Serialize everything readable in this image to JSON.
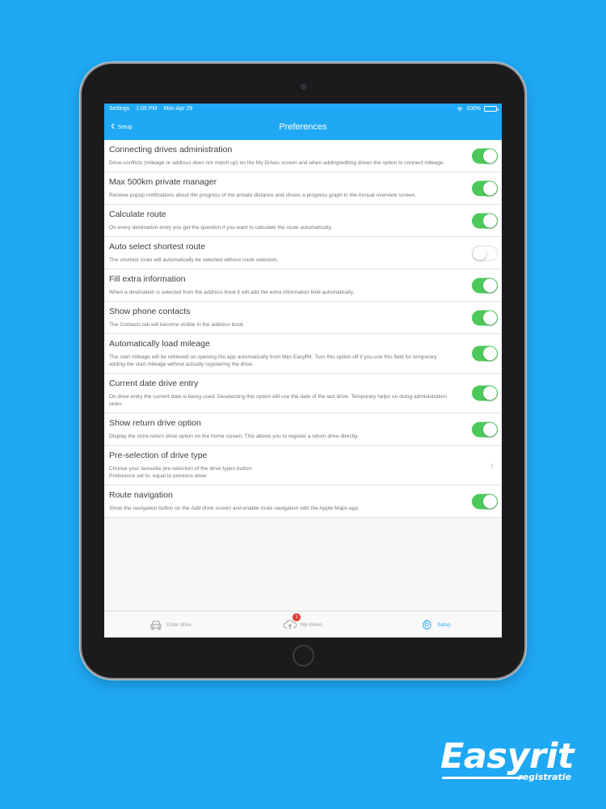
{
  "status_bar": {
    "carrier": "Settings",
    "time": "1:05 PM",
    "date": "Mon Apr 29",
    "battery": "100%",
    "battery_level": 1.0
  },
  "nav": {
    "back_label": "Setup",
    "title": "Preferences"
  },
  "preferences": [
    {
      "title": "Connecting drives administration",
      "description": "Drive-conflicts (mileage or address does not match up) on the My Drives screen and when adding/editing drives the option to connect mileage.",
      "control": "toggle",
      "on": true
    },
    {
      "title": "Max 500km private manager",
      "description": "Receive popup notifications about the progress of the private distance and shows a progress graph in the Annual overview screen.",
      "control": "toggle",
      "on": true
    },
    {
      "title": "Calculate route",
      "description": "On every destination entry you get the question if you want to calculate the route automatically.",
      "control": "toggle",
      "on": true
    },
    {
      "title": "Auto select shortest route",
      "description": "The shortest route will automatically be selected without route selection.",
      "control": "toggle",
      "on": false
    },
    {
      "title": "Fill extra information",
      "description": "When a destination is selected from the address book it will add the extra information field automatically.",
      "control": "toggle",
      "on": true
    },
    {
      "title": "Show phone contacts",
      "description": "The Contacts tab will become visible in the address book.",
      "control": "toggle",
      "on": true
    },
    {
      "title": "Automatically load mileage",
      "description": "The start mileage will be retrieved on opening the app automatically from Mijn EasyRit. Turn this option off if you use this field for temporary adding the start mileage without actually registering the drive.",
      "control": "toggle",
      "on": true
    },
    {
      "title": "Current date drive entry",
      "description": "On drive entry the current date is being used. Deselecting this option will use the date of the last drive. Temporary helps on doing administration tasks.",
      "control": "toggle",
      "on": true
    },
    {
      "title": "Show return drive option",
      "description": "Display the store return drive option on the home screen. This allows you to register a return drive directly.",
      "control": "toggle",
      "on": true
    },
    {
      "title": "Pre-selection of drive type",
      "description": "Choose your favourite pre-selection of the drive types button.",
      "description_line2": "Preference set to: equal to previous drive",
      "control": "disclosure"
    },
    {
      "title": "Route navigation",
      "description_prefix": "Show the navigation button on the ",
      "description_em": "Add drive",
      "description_suffix": " screen and enable route navigation with the Apple Maps app.",
      "control": "toggle",
      "on": true
    }
  ],
  "tabbar": {
    "tabs": [
      {
        "label": "Enter drive",
        "icon": "car-icon",
        "active": false
      },
      {
        "label": "My drives",
        "icon": "cloud-upload-icon",
        "active": false,
        "badge": "1"
      },
      {
        "label": "Setup",
        "icon": "gear-icon",
        "active": true
      }
    ]
  },
  "logo": {
    "main": "Easyrit",
    "sub": "registratie"
  },
  "colors": {
    "accent": "#1fa8f4",
    "toggle_on": "#4cc95a",
    "badge": "#e53935"
  }
}
